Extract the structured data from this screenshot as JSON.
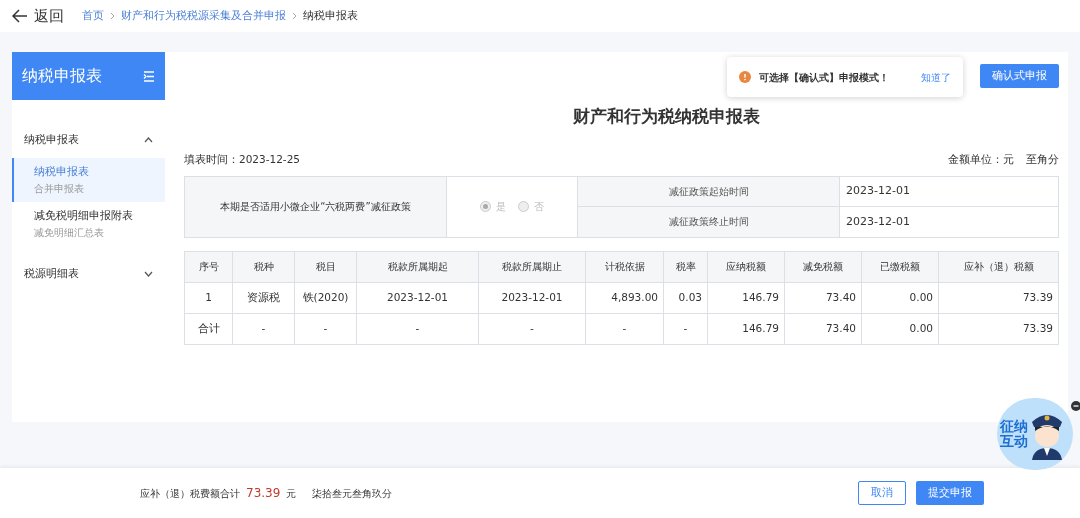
{
  "header": {
    "back": "返回",
    "breadcrumbs": [
      {
        "label": "首页",
        "link": true
      },
      {
        "label": "财产和行为税税源采集及合并申报",
        "link": true
      },
      {
        "label": "纳税申报表",
        "link": false
      }
    ]
  },
  "sidebar": {
    "title": "纳税申报表",
    "groups": [
      {
        "label": "纳税申报表",
        "expanded": true,
        "items": [
          {
            "label": "纳税申报表",
            "sub": "合并申报表",
            "selected": true
          },
          {
            "label": "减免税明细申报附表",
            "sub": "减免明细汇总表",
            "selected": false
          }
        ]
      },
      {
        "label": "税源明细表",
        "expanded": false
      }
    ]
  },
  "notice": {
    "text": "可选择【确认式】申报模式！",
    "action": "知道了"
  },
  "confirm_button": "确认式申报",
  "form_title": "财产和行为税纳税申报表",
  "fill_date": "填表时间：2023-12-25",
  "unit": "金额单位：元",
  "precision": "至角分",
  "policy": {
    "question": "本期是否适用小微企业“六税两费”减征政策",
    "disabled": true,
    "options": [
      {
        "label": "是",
        "selected": true
      },
      {
        "label": "否",
        "selected": false
      }
    ],
    "dates": [
      {
        "label": "减征政策起始时间",
        "value": "2023-12-01"
      },
      {
        "label": "减征政策终止时间",
        "value": "2023-12-01"
      }
    ]
  },
  "table": {
    "columns": [
      "序号",
      "税种",
      "税目",
      "税款所属期起",
      "税款所属期止",
      "计税依据",
      "税率",
      "应纳税额",
      "减免税额",
      "已缴税额",
      "应补（退）税额"
    ],
    "rows": [
      [
        "1",
        "资源税",
        "铁(2020)",
        "2023-12-01",
        "2023-12-01",
        "4,893.00",
        "0.03",
        "146.79",
        "73.40",
        "0.00",
        "73.39"
      ],
      [
        "合计",
        "-",
        "-",
        "-",
        "-",
        "-",
        "-",
        "146.79",
        "73.40",
        "0.00",
        "73.39"
      ]
    ]
  },
  "footer": {
    "label": "应补（退）税费额合计",
    "amount": "73.39",
    "currency": "元",
    "in_words": "柒拾叁元叁角玖分",
    "buttons": [
      {
        "label": "取消",
        "primary": false
      },
      {
        "label": "提交申报",
        "primary": true
      }
    ]
  },
  "widget": {
    "label": "征纳互动"
  }
}
